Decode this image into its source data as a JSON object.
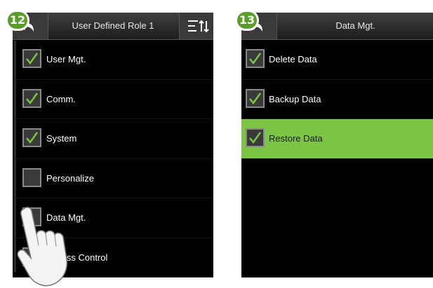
{
  "steps": [
    "12",
    "13"
  ],
  "left_screen": {
    "title": "User Defined Role 1",
    "items": [
      {
        "label": "User Mgt.",
        "checked": true
      },
      {
        "label": "Comm.",
        "checked": true
      },
      {
        "label": "System",
        "checked": true
      },
      {
        "label": "Personalize",
        "checked": false
      },
      {
        "label": "Data Mgt.",
        "checked": false
      },
      {
        "label": "Access Control",
        "checked": true
      }
    ]
  },
  "right_screen": {
    "title": "Data Mgt.",
    "items": [
      {
        "label": "Delete Data",
        "checked": true,
        "selected": false
      },
      {
        "label": "Backup Data",
        "checked": true,
        "selected": false
      },
      {
        "label": "Restore Data",
        "checked": true,
        "selected": true
      }
    ]
  },
  "colors": {
    "check": "#7cc444",
    "highlight": "#7cc444",
    "badge": "#5a9e2a"
  },
  "icons": {
    "back": "back-arrow-icon",
    "sort": "sort-icon",
    "check": "check-icon",
    "hand": "pointing-hand-icon"
  }
}
